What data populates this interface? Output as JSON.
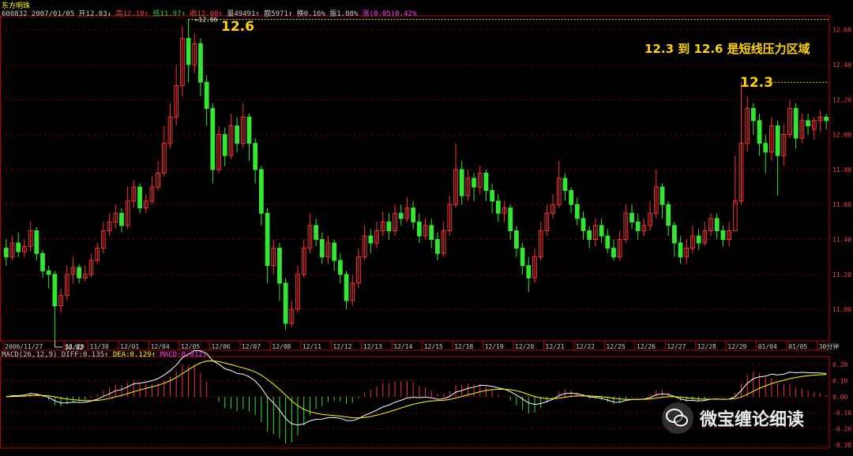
{
  "header": {
    "name": "东方明珠",
    "quote_parts": [
      {
        "text": "600832  2007/01/05  开12.03↓",
        "color": "#cccccc"
      },
      {
        "text": " 高12.10↑",
        "color": "#ff4040"
      },
      {
        "text": " 低11.97↑",
        "color": "#3dd63d"
      },
      {
        "text": " 收12.08↑",
        "color": "#ff4040"
      },
      {
        "text": " 量49491↑",
        "color": "#cccccc"
      },
      {
        "text": " 额5971↑",
        "color": "#cccccc"
      },
      {
        "text": " 换0.16%",
        "color": "#cccccc"
      },
      {
        "text": " 振1.08%",
        "color": "#cccccc"
      },
      {
        "text": " 涨(0.05)0.42%",
        "color": "#ff40ff"
      }
    ]
  },
  "macd_header": {
    "parts": [
      {
        "text": "MACD(26,12,9)  DIFF:0.135↑",
        "color": "#cccccc"
      },
      {
        "text": " DEA:0.129↑",
        "color": "#ffff00"
      },
      {
        "text": " MACD:0.012↓",
        "color": "#ff40ff"
      }
    ]
  },
  "annotations": {
    "label_high": "12.6",
    "label_mid": "12.3",
    "pressure_text": "12.3 到 12.6 是短线压力区域"
  },
  "watermark": {
    "text": "微宝缠论细读",
    "icon": "wechat-icon"
  },
  "colors": {
    "up": "#ff3232",
    "down": "#32e632",
    "diff": "#ffffff",
    "dea": "#ffff00",
    "axis": "#c00000",
    "grid": "#6b0000",
    "peak_line": "#ffff00"
  },
  "chart_data": [
    {
      "type": "candlestick",
      "title": "东方明珠 600832 30分钟",
      "period": "30分钟",
      "ylim": [
        10.82,
        12.68
      ],
      "yticks": [
        11.0,
        11.2,
        11.4,
        11.6,
        11.8,
        12.0,
        12.2,
        12.4,
        12.6
      ],
      "x_labels": [
        {
          "label": "2006/11/27",
          "i": 0
        },
        {
          "label": "11/29",
          "i": 10
        },
        {
          "label": "11/30",
          "i": 14
        },
        {
          "label": "12/01",
          "i": 19
        },
        {
          "label": "12/04",
          "i": 24
        },
        {
          "label": "12/05",
          "i": 29
        },
        {
          "label": "12/06",
          "i": 34
        },
        {
          "label": "12/07",
          "i": 39
        },
        {
          "label": "12/08",
          "i": 44
        },
        {
          "label": "12/11",
          "i": 49
        },
        {
          "label": "12/12",
          "i": 54
        },
        {
          "label": "12/13",
          "i": 59
        },
        {
          "label": "12/14",
          "i": 64
        },
        {
          "label": "12/15",
          "i": 69
        },
        {
          "label": "12/18",
          "i": 74
        },
        {
          "label": "12/19",
          "i": 79
        },
        {
          "label": "12/20",
          "i": 84
        },
        {
          "label": "12/21",
          "i": 89
        },
        {
          "label": "12/22",
          "i": 94
        },
        {
          "label": "12/25",
          "i": 99
        },
        {
          "label": "12/26",
          "i": 104
        },
        {
          "label": "12/27",
          "i": 109
        },
        {
          "label": "12/28",
          "i": 114
        },
        {
          "label": "12/29",
          "i": 119
        },
        {
          "label": "01/04",
          "i": 124
        },
        {
          "label": "01/05",
          "i": 129
        },
        {
          "label": "30分钟",
          "i": 134
        }
      ],
      "marked_low": {
        "label": "10.82",
        "i": 8,
        "value": 10.82
      },
      "marked_high": {
        "label": "12.66",
        "i": 30,
        "value": 12.66
      },
      "candles": [
        [
          11.35,
          11.3,
          11.4,
          11.25
        ],
        [
          11.3,
          11.38,
          11.42,
          11.28
        ],
        [
          11.38,
          11.33,
          11.44,
          11.3
        ],
        [
          11.33,
          11.36,
          11.4,
          11.3
        ],
        [
          11.36,
          11.45,
          11.5,
          11.33
        ],
        [
          11.45,
          11.32,
          11.47,
          11.28
        ],
        [
          11.32,
          11.22,
          11.34,
          11.18
        ],
        [
          11.22,
          11.2,
          11.25,
          11.12
        ],
        [
          11.2,
          11.02,
          11.22,
          10.82
        ],
        [
          11.02,
          11.08,
          11.12,
          10.98
        ],
        [
          11.08,
          11.2,
          11.25,
          11.05
        ],
        [
          11.2,
          11.24,
          11.3,
          11.15
        ],
        [
          11.24,
          11.18,
          11.26,
          11.15
        ],
        [
          11.18,
          11.2,
          11.25,
          11.16
        ],
        [
          11.2,
          11.28,
          11.32,
          11.18
        ],
        [
          11.28,
          11.35,
          11.38,
          11.26
        ],
        [
          11.35,
          11.45,
          11.5,
          11.32
        ],
        [
          11.45,
          11.5,
          11.55,
          11.42
        ],
        [
          11.5,
          11.55,
          11.6,
          11.46
        ],
        [
          11.55,
          11.48,
          11.58,
          11.44
        ],
        [
          11.48,
          11.62,
          11.7,
          11.46
        ],
        [
          11.62,
          11.7,
          11.74,
          11.58
        ],
        [
          11.7,
          11.58,
          11.72,
          11.55
        ],
        [
          11.58,
          11.62,
          11.66,
          11.55
        ],
        [
          11.62,
          11.7,
          11.76,
          11.6
        ],
        [
          11.7,
          11.78,
          11.85,
          11.68
        ],
        [
          11.78,
          11.95,
          12.05,
          11.76
        ],
        [
          11.95,
          12.1,
          12.18,
          11.92
        ],
        [
          12.1,
          12.28,
          12.4,
          12.05
        ],
        [
          12.28,
          12.55,
          12.62,
          12.22
        ],
        [
          12.55,
          12.4,
          12.66,
          12.3
        ],
        [
          12.4,
          12.52,
          12.58,
          12.35
        ],
        [
          12.52,
          12.3,
          12.55,
          12.22
        ],
        [
          12.3,
          12.15,
          12.34,
          12.05
        ],
        [
          12.15,
          11.8,
          12.18,
          11.72
        ],
        [
          11.8,
          12.0,
          12.05,
          11.78
        ],
        [
          12.0,
          11.88,
          12.04,
          11.82
        ],
        [
          11.88,
          12.05,
          12.12,
          11.86
        ],
        [
          12.05,
          11.95,
          12.1,
          11.9
        ],
        [
          11.95,
          12.1,
          12.18,
          11.92
        ],
        [
          12.1,
          11.95,
          12.12,
          11.85
        ],
        [
          11.95,
          11.8,
          11.98,
          11.72
        ],
        [
          11.8,
          11.55,
          11.82,
          11.48
        ],
        [
          11.55,
          11.25,
          11.58,
          11.15
        ],
        [
          11.25,
          11.35,
          11.4,
          11.2
        ],
        [
          11.35,
          11.15,
          11.38,
          11.05
        ],
        [
          11.15,
          10.92,
          11.18,
          10.88
        ],
        [
          10.92,
          11.0,
          11.05,
          10.9
        ],
        [
          11.0,
          11.2,
          11.25,
          10.98
        ],
        [
          11.2,
          11.35,
          11.4,
          11.18
        ],
        [
          11.35,
          11.48,
          11.55,
          11.32
        ],
        [
          11.48,
          11.4,
          11.52,
          11.36
        ],
        [
          11.4,
          11.3,
          11.44,
          11.26
        ],
        [
          11.3,
          11.38,
          11.42,
          11.26
        ],
        [
          11.38,
          11.28,
          11.4,
          11.22
        ],
        [
          11.28,
          11.2,
          11.32,
          11.15
        ],
        [
          11.2,
          11.05,
          11.22,
          11.0
        ],
        [
          11.05,
          11.15,
          11.2,
          11.02
        ],
        [
          11.15,
          11.3,
          11.35,
          11.12
        ],
        [
          11.3,
          11.42,
          11.48,
          11.28
        ],
        [
          11.42,
          11.38,
          11.46,
          11.32
        ],
        [
          11.38,
          11.45,
          11.5,
          11.35
        ],
        [
          11.45,
          11.5,
          11.56,
          11.42
        ],
        [
          11.5,
          11.45,
          11.55,
          11.4
        ],
        [
          11.45,
          11.55,
          11.6,
          11.42
        ],
        [
          11.55,
          11.52,
          11.6,
          11.48
        ],
        [
          11.52,
          11.58,
          11.64,
          11.5
        ],
        [
          11.58,
          11.5,
          11.62,
          11.46
        ],
        [
          11.5,
          11.42,
          11.55,
          11.38
        ],
        [
          11.42,
          11.48,
          11.52,
          11.4
        ],
        [
          11.48,
          11.4,
          11.52,
          11.35
        ],
        [
          11.4,
          11.32,
          11.44,
          11.28
        ],
        [
          11.32,
          11.45,
          11.5,
          11.3
        ],
        [
          11.45,
          11.6,
          11.65,
          11.42
        ],
        [
          11.6,
          11.8,
          11.95,
          11.58
        ],
        [
          11.8,
          11.65,
          11.85,
          11.6
        ],
        [
          11.65,
          11.75,
          11.8,
          11.62
        ],
        [
          11.75,
          11.7,
          11.78,
          11.62
        ],
        [
          11.7,
          11.78,
          11.82,
          11.66
        ],
        [
          11.78,
          11.68,
          11.8,
          11.62
        ],
        [
          11.68,
          11.62,
          11.72,
          11.55
        ],
        [
          11.62,
          11.55,
          11.66,
          11.5
        ],
        [
          11.55,
          11.58,
          11.62,
          11.5
        ],
        [
          11.58,
          11.45,
          11.6,
          11.4
        ],
        [
          11.45,
          11.35,
          11.48,
          11.3
        ],
        [
          11.35,
          11.25,
          11.38,
          11.2
        ],
        [
          11.25,
          11.18,
          11.3,
          11.1
        ],
        [
          11.18,
          11.3,
          11.35,
          11.15
        ],
        [
          11.3,
          11.45,
          11.5,
          11.28
        ],
        [
          11.45,
          11.55,
          11.6,
          11.42
        ],
        [
          11.55,
          11.6,
          11.66,
          11.52
        ],
        [
          11.6,
          11.75,
          11.85,
          11.58
        ],
        [
          11.75,
          11.68,
          11.78,
          11.62
        ],
        [
          11.68,
          11.6,
          11.7,
          11.55
        ],
        [
          11.6,
          11.52,
          11.64,
          11.48
        ],
        [
          11.52,
          11.45,
          11.56,
          11.4
        ],
        [
          11.45,
          11.4,
          11.48,
          11.35
        ],
        [
          11.4,
          11.48,
          11.52,
          11.36
        ],
        [
          11.48,
          11.42,
          11.52,
          11.38
        ],
        [
          11.42,
          11.35,
          11.46,
          11.32
        ],
        [
          11.35,
          11.3,
          11.4,
          11.28
        ],
        [
          11.3,
          11.4,
          11.45,
          11.28
        ],
        [
          11.4,
          11.55,
          11.6,
          11.38
        ],
        [
          11.55,
          11.5,
          11.6,
          11.46
        ],
        [
          11.5,
          11.45,
          11.55,
          11.4
        ],
        [
          11.45,
          11.48,
          11.52,
          11.42
        ],
        [
          11.48,
          11.55,
          11.62,
          11.45
        ],
        [
          11.55,
          11.7,
          11.8,
          11.52
        ],
        [
          11.7,
          11.6,
          11.72,
          11.52
        ],
        [
          11.6,
          11.48,
          11.62,
          11.42
        ],
        [
          11.48,
          11.38,
          11.5,
          11.3
        ],
        [
          11.38,
          11.3,
          11.42,
          11.26
        ],
        [
          11.3,
          11.35,
          11.4,
          11.26
        ],
        [
          11.35,
          11.42,
          11.48,
          11.32
        ],
        [
          11.42,
          11.38,
          11.46,
          11.34
        ],
        [
          11.38,
          11.45,
          11.5,
          11.36
        ],
        [
          11.45,
          11.52,
          11.55,
          11.42
        ],
        [
          11.52,
          11.45,
          11.55,
          11.4
        ],
        [
          11.45,
          11.4,
          11.48,
          11.36
        ],
        [
          11.4,
          11.45,
          11.5,
          11.36
        ],
        [
          11.45,
          11.62,
          11.88,
          11.6
        ],
        [
          11.62,
          11.95,
          12.3,
          11.6
        ],
        [
          11.95,
          12.15,
          12.22,
          11.9
        ],
        [
          12.15,
          12.08,
          12.18,
          12.0
        ],
        [
          12.08,
          11.95,
          12.12,
          11.88
        ],
        [
          11.95,
          11.9,
          12.0,
          11.78
        ],
        [
          11.9,
          12.05,
          12.1,
          11.85
        ],
        [
          12.05,
          11.88,
          12.08,
          11.65
        ],
        [
          11.88,
          12.0,
          12.06,
          11.82
        ],
        [
          12.0,
          12.15,
          12.2,
          11.98
        ],
        [
          12.15,
          11.98,
          12.18,
          11.92
        ],
        [
          11.98,
          12.08,
          12.12,
          11.95
        ],
        [
          12.08,
          12.05,
          12.12,
          12.0
        ],
        [
          12.03,
          12.08,
          12.1,
          11.97
        ],
        [
          12.08,
          12.1,
          12.14,
          12.02
        ],
        [
          12.1,
          12.08,
          12.12,
          12.03
        ]
      ]
    },
    {
      "type": "macd",
      "title": "MACD(26,12,9)",
      "ylim": [
        -0.32,
        0.25
      ],
      "yticks": [
        0.2,
        0.1,
        0.0,
        -0.1,
        -0.2,
        -0.3
      ],
      "diff_last": 0.135,
      "dea_last": 0.129,
      "macd_last": 0.012
    }
  ]
}
